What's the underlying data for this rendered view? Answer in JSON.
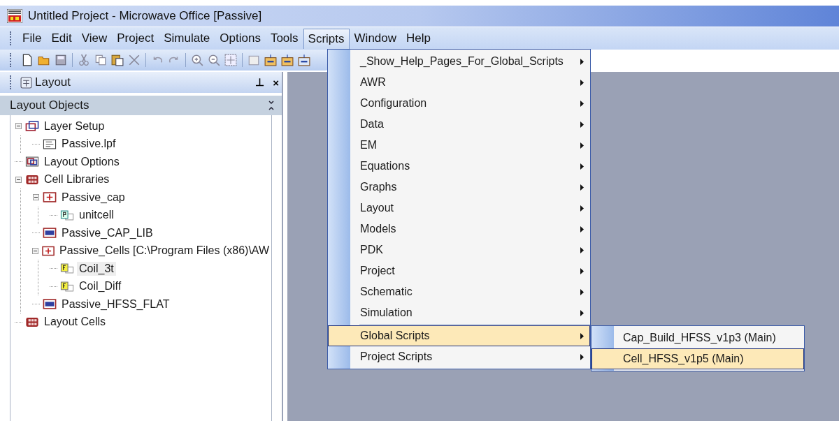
{
  "window": {
    "title": "Untitled Project - Microwave Office [Passive]"
  },
  "menubar": [
    {
      "label": "File",
      "selected": false
    },
    {
      "label": "Edit",
      "selected": false
    },
    {
      "label": "View",
      "selected": false
    },
    {
      "label": "Project",
      "selected": false
    },
    {
      "label": "Simulate",
      "selected": false
    },
    {
      "label": "Options",
      "selected": false
    },
    {
      "label": "Tools",
      "selected": false
    },
    {
      "label": "Scripts",
      "selected": true
    },
    {
      "label": "Window",
      "selected": false
    },
    {
      "label": "Help",
      "selected": false
    }
  ],
  "layout_pane": {
    "title": "Layout",
    "pin": "⊥",
    "close": "×",
    "section": "Layout Objects"
  },
  "tree": [
    {
      "label": "Layer Setup",
      "kind": "layers",
      "expanded": true,
      "selected": false,
      "children": [
        {
          "label": "Passive.lpf",
          "kind": "file",
          "selected": false
        }
      ]
    },
    {
      "label": "Layout Options",
      "kind": "options",
      "selected": false
    },
    {
      "label": "Cell Libraries",
      "kind": "library",
      "expanded": true,
      "selected": false,
      "children": [
        {
          "label": "Passive_cap",
          "kind": "celllib",
          "expanded": true,
          "selected": false,
          "children": [
            {
              "label": "unitcell",
              "kind": "pcell",
              "selected": false
            }
          ]
        },
        {
          "label": "Passive_CAP_LIB",
          "kind": "gds",
          "selected": false
        },
        {
          "label": "Passive_Cells [C:\\Program Files (x86)\\AW",
          "kind": "celllib",
          "expanded": true,
          "selected": false,
          "children": [
            {
              "label": "Coil_3t",
              "kind": "fcell",
              "selected": true
            },
            {
              "label": "Coil_Diff",
              "kind": "fcell",
              "selected": false
            }
          ]
        },
        {
          "label": "Passive_HFSS_FLAT",
          "kind": "gds",
          "selected": false
        }
      ]
    },
    {
      "label": "Layout Cells",
      "kind": "library",
      "selected": false
    }
  ],
  "scripts_menu": {
    "groups": [
      [
        {
          "label": "_Show_Help_Pages_For_Global_Scripts",
          "selected": false
        },
        {
          "label": "AWR",
          "selected": false
        },
        {
          "label": "Configuration",
          "selected": false
        },
        {
          "label": "Data",
          "selected": false
        },
        {
          "label": "EM",
          "selected": false
        },
        {
          "label": "Equations",
          "selected": false
        },
        {
          "label": "Graphs",
          "selected": false
        },
        {
          "label": "Layout",
          "selected": false
        },
        {
          "label": "Models",
          "selected": false
        },
        {
          "label": "PDK",
          "selected": false
        },
        {
          "label": "Project",
          "selected": false
        },
        {
          "label": "Schematic",
          "selected": false
        },
        {
          "label": "Simulation",
          "selected": false
        }
      ],
      [
        {
          "label": "Global Scripts",
          "selected": true
        },
        {
          "label": "Project Scripts",
          "selected": false
        }
      ]
    ]
  },
  "global_scripts_submenu": [
    {
      "label": "Cap_Build_HFSS_v1p3 (Main)",
      "selected": false
    },
    {
      "label": "Cell_HFSS_v1p5 (Main)",
      "selected": true
    }
  ]
}
